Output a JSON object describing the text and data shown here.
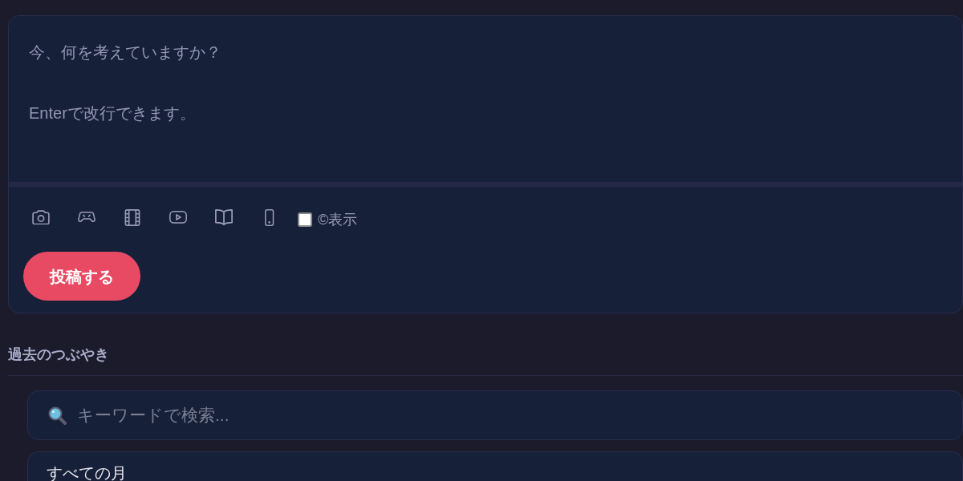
{
  "composer": {
    "placeholder": "今、何を考えていますか？\n\nEnterで改行できます。",
    "tools": [
      {
        "kind": "camera"
      },
      {
        "kind": "gamepad"
      },
      {
        "kind": "film"
      },
      {
        "kind": "video"
      },
      {
        "kind": "book"
      },
      {
        "kind": "phone"
      }
    ],
    "checkbox": {
      "label": "©表示",
      "checked": false
    },
    "submit": "投稿する"
  },
  "history": {
    "title": "過去のつぶやき",
    "search": {
      "placeholder": "キーワードで検索..."
    },
    "month_filter": {
      "value": "すべての月"
    }
  }
}
